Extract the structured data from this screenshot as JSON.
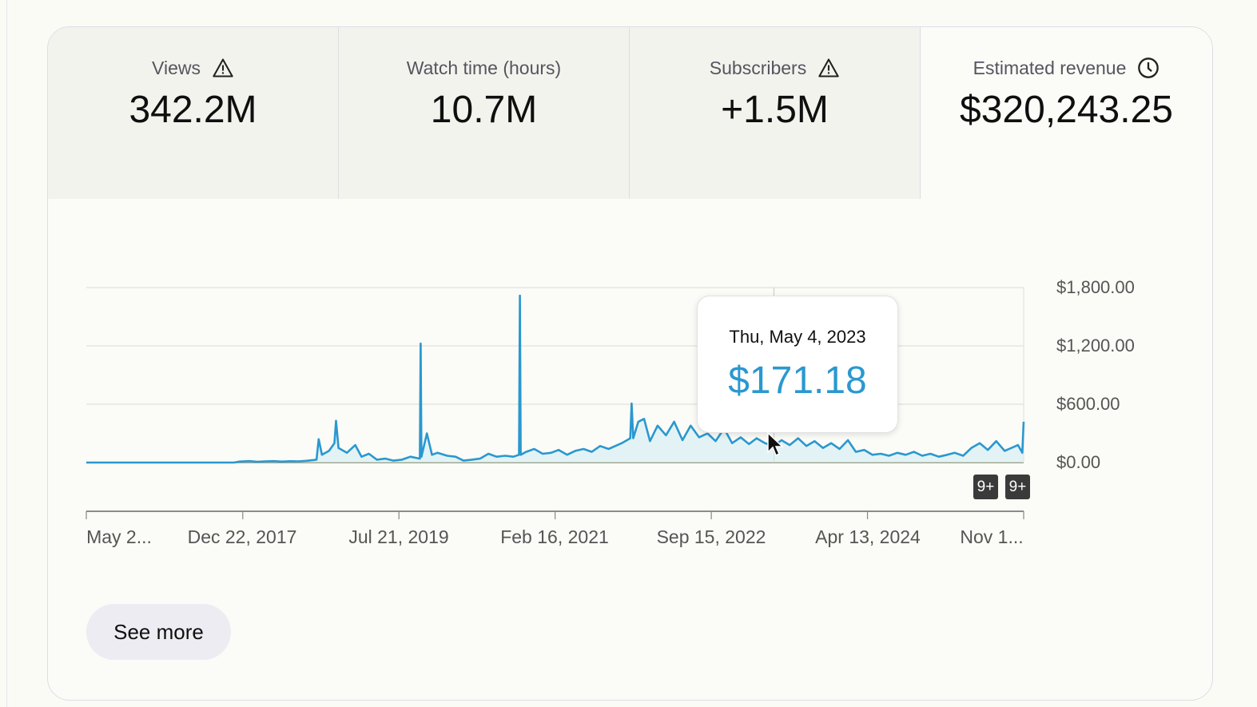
{
  "metrics": [
    {
      "label": "Views",
      "value": "342.2M",
      "icon": "warning-triangle-icon"
    },
    {
      "label": "Watch time (hours)",
      "value": "10.7M",
      "icon": ""
    },
    {
      "label": "Subscribers",
      "value": "+1.5M",
      "icon": "warning-triangle-icon"
    },
    {
      "label": "Estimated revenue",
      "value": "$320,243.25",
      "icon": "clock-icon",
      "selected": true
    }
  ],
  "tooltip": {
    "date": "Thu, May 4, 2023",
    "value": "$171.18"
  },
  "badges": [
    "9+",
    "9+"
  ],
  "see_more": "See more",
  "colors": {
    "line": "#2a98d0",
    "area": "#d4eef3",
    "tooltip_value": "#2a98d0",
    "badge": "#3a3a3a"
  },
  "chart_data": {
    "type": "line",
    "y_tick_labels": [
      "$1,800.00",
      "$1,200.00",
      "$600.00",
      "$0.00"
    ],
    "y_ticks": [
      1800,
      1200,
      600,
      0
    ],
    "ylim": [
      0,
      1800
    ],
    "x_tick_labels": [
      "May 2...",
      "Dec 22, 2017",
      "Jul 21, 2019",
      "Feb 16, 2021",
      "Sep 15, 2022",
      "Apr 13, 2024",
      "Nov 1..."
    ],
    "x_ticks": [
      "2016-05-24",
      "2017-12-22",
      "2019-07-21",
      "2021-02-16",
      "2022-09-15",
      "2024-04-13",
      "2025-11-10"
    ],
    "xlim": [
      "2016-05-24",
      "2025-11-10"
    ],
    "grid": true,
    "hover_date": "2023-05-04",
    "series": [
      {
        "points": [
          [
            "2016-05-24",
            0
          ],
          [
            "2017-01-01",
            0
          ],
          [
            "2017-11-20",
            0
          ],
          [
            "2017-12-10",
            10
          ],
          [
            "2018-01-15",
            15
          ],
          [
            "2018-02-15",
            8
          ],
          [
            "2018-03-15",
            12
          ],
          [
            "2018-04-15",
            15
          ],
          [
            "2018-05-15",
            10
          ],
          [
            "2018-06-15",
            14
          ],
          [
            "2018-07-15",
            12
          ],
          [
            "2018-08-15",
            18
          ],
          [
            "2018-09-20",
            30
          ],
          [
            "2018-09-28",
            240
          ],
          [
            "2018-10-10",
            80
          ],
          [
            "2018-11-05",
            120
          ],
          [
            "2018-11-25",
            200
          ],
          [
            "2018-12-01",
            430
          ],
          [
            "2018-12-10",
            150
          ],
          [
            "2019-01-10",
            100
          ],
          [
            "2019-02-10",
            180
          ],
          [
            "2019-03-05",
            60
          ],
          [
            "2019-04-01",
            90
          ],
          [
            "2019-05-01",
            30
          ],
          [
            "2019-06-01",
            40
          ],
          [
            "2019-07-01",
            20
          ],
          [
            "2019-08-01",
            30
          ],
          [
            "2019-09-01",
            60
          ],
          [
            "2019-10-06",
            40
          ],
          [
            "2019-10-09",
            1225
          ],
          [
            "2019-10-12",
            60
          ],
          [
            "2019-11-01",
            300
          ],
          [
            "2019-11-20",
            80
          ],
          [
            "2019-12-10",
            100
          ],
          [
            "2020-01-15",
            70
          ],
          [
            "2020-02-15",
            60
          ],
          [
            "2020-03-15",
            20
          ],
          [
            "2020-04-15",
            30
          ],
          [
            "2020-05-15",
            40
          ],
          [
            "2020-06-15",
            90
          ],
          [
            "2020-07-15",
            60
          ],
          [
            "2020-08-15",
            70
          ],
          [
            "2020-09-15",
            60
          ],
          [
            "2020-10-06",
            80
          ],
          [
            "2020-10-09",
            1718
          ],
          [
            "2020-10-12",
            80
          ],
          [
            "2020-11-01",
            110
          ],
          [
            "2020-12-01",
            140
          ],
          [
            "2021-01-01",
            90
          ],
          [
            "2021-02-01",
            100
          ],
          [
            "2021-03-01",
            130
          ],
          [
            "2021-04-01",
            80
          ],
          [
            "2021-05-01",
            120
          ],
          [
            "2021-06-01",
            140
          ],
          [
            "2021-07-01",
            110
          ],
          [
            "2021-08-01",
            170
          ],
          [
            "2021-09-01",
            140
          ],
          [
            "2021-10-20",
            200
          ],
          [
            "2021-11-20",
            250
          ],
          [
            "2021-11-25",
            608
          ],
          [
            "2021-12-01",
            250
          ],
          [
            "2021-12-20",
            420
          ],
          [
            "2022-01-10",
            450
          ],
          [
            "2022-02-01",
            220
          ],
          [
            "2022-03-01",
            380
          ],
          [
            "2022-04-01",
            280
          ],
          [
            "2022-05-01",
            420
          ],
          [
            "2022-06-01",
            230
          ],
          [
            "2022-07-01",
            380
          ],
          [
            "2022-08-01",
            260
          ],
          [
            "2022-09-01",
            300
          ],
          [
            "2022-10-01",
            220
          ],
          [
            "2022-11-01",
            350
          ],
          [
            "2022-12-01",
            200
          ],
          [
            "2023-01-01",
            260
          ],
          [
            "2023-02-01",
            190
          ],
          [
            "2023-03-01",
            250
          ],
          [
            "2023-04-01",
            200
          ],
          [
            "2023-05-04",
            171.18
          ],
          [
            "2023-06-01",
            230
          ],
          [
            "2023-07-01",
            180
          ],
          [
            "2023-08-01",
            250
          ],
          [
            "2023-09-01",
            170
          ],
          [
            "2023-10-01",
            220
          ],
          [
            "2023-11-01",
            150
          ],
          [
            "2023-12-01",
            200
          ],
          [
            "2024-01-01",
            140
          ],
          [
            "2024-02-01",
            230
          ],
          [
            "2024-03-01",
            110
          ],
          [
            "2024-04-01",
            130
          ],
          [
            "2024-05-01",
            80
          ],
          [
            "2024-06-01",
            90
          ],
          [
            "2024-07-01",
            70
          ],
          [
            "2024-08-01",
            100
          ],
          [
            "2024-09-01",
            80
          ],
          [
            "2024-10-01",
            110
          ],
          [
            "2024-11-01",
            70
          ],
          [
            "2024-12-01",
            90
          ],
          [
            "2025-01-01",
            60
          ],
          [
            "2025-02-01",
            80
          ],
          [
            "2025-03-01",
            100
          ],
          [
            "2025-04-01",
            70
          ],
          [
            "2025-05-01",
            150
          ],
          [
            "2025-06-01",
            200
          ],
          [
            "2025-07-01",
            130
          ],
          [
            "2025-08-01",
            220
          ],
          [
            "2025-09-01",
            120
          ],
          [
            "2025-10-20",
            180
          ],
          [
            "2025-11-05",
            100
          ],
          [
            "2025-11-10",
            420
          ]
        ]
      }
    ]
  }
}
